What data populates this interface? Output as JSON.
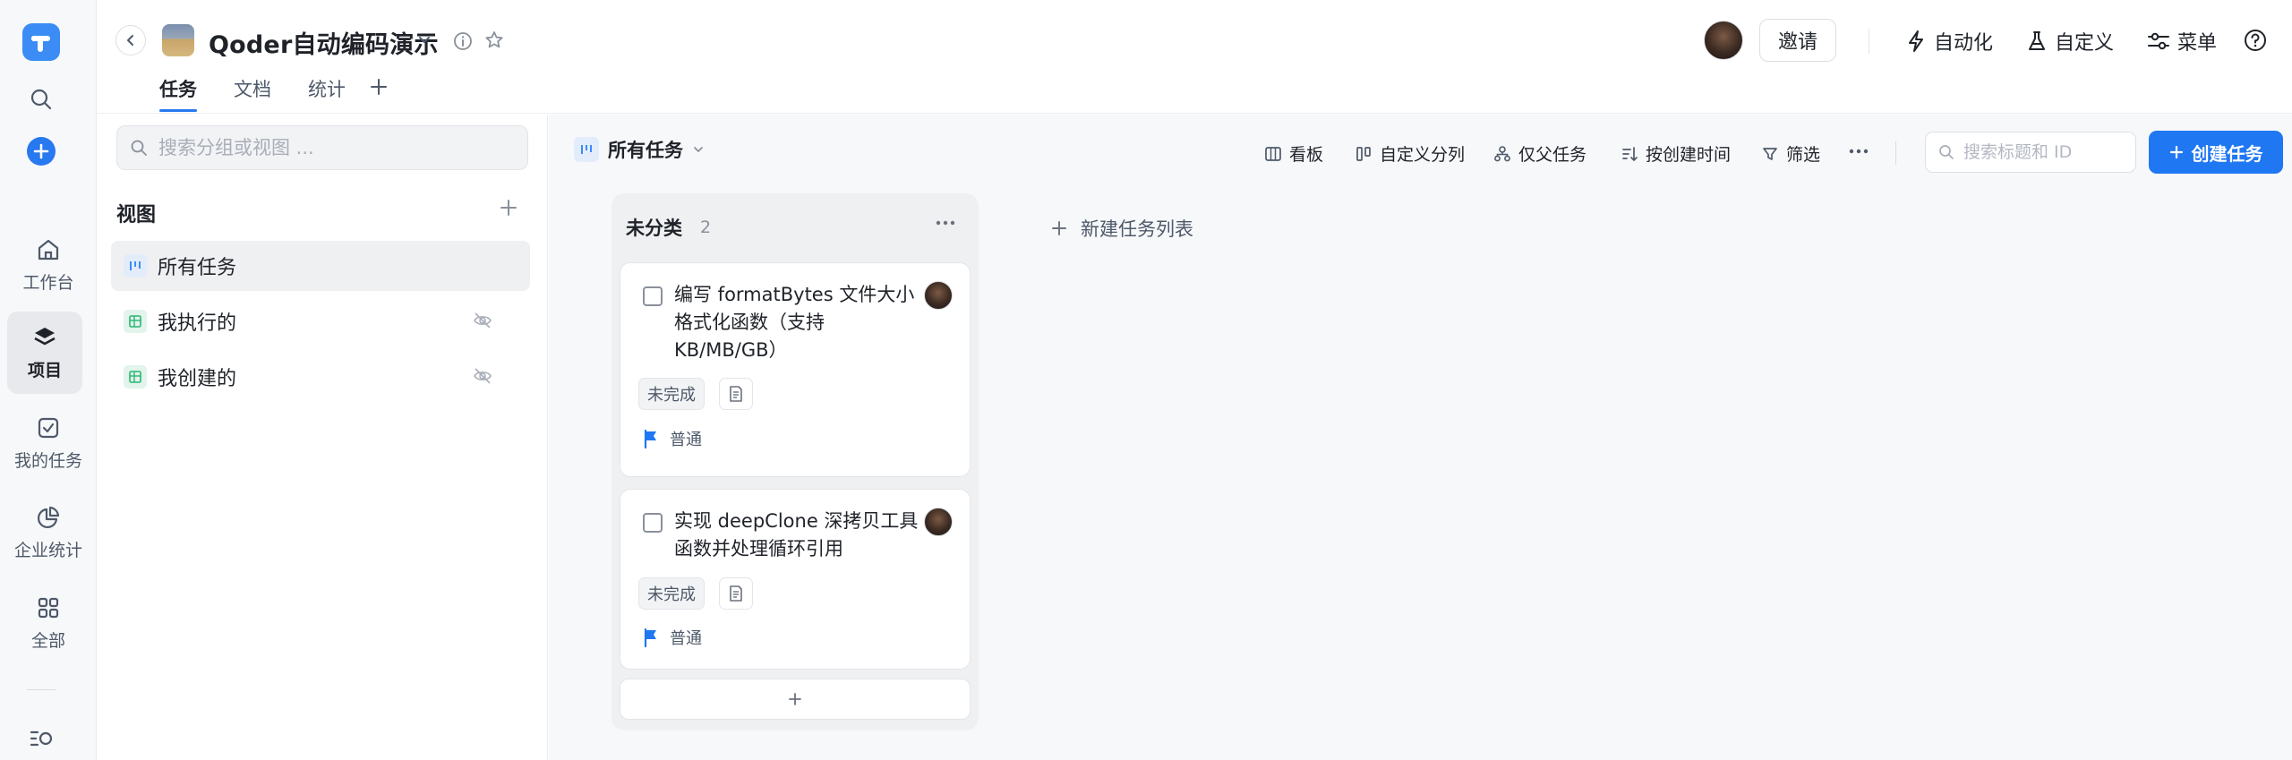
{
  "project": {
    "title": "Qoder自动编码演示"
  },
  "tabs": [
    {
      "label": "任务",
      "active": true
    },
    {
      "label": "文档",
      "active": false
    },
    {
      "label": "统计",
      "active": false
    }
  ],
  "rail": {
    "items": [
      {
        "label": "工作台",
        "icon": "home-icon"
      },
      {
        "label": "项目",
        "icon": "layers-icon",
        "active": true
      },
      {
        "label": "我的任务",
        "icon": "checkbox-icon"
      },
      {
        "label": "企业统计",
        "icon": "pie-chart-icon"
      },
      {
        "label": "全部",
        "icon": "grid-icon"
      }
    ]
  },
  "header": {
    "invite_label": "邀请",
    "automation_label": "自动化",
    "customize_label": "自定义",
    "menu_label": "菜单"
  },
  "views_panel": {
    "search_placeholder": "搜索分组或视图 ...",
    "title": "视图",
    "items": [
      {
        "label": "所有任务",
        "active": true,
        "icon": "board-view-icon"
      },
      {
        "label": "我执行的",
        "active": false,
        "icon": "table-view-icon",
        "hidden": true
      },
      {
        "label": "我创建的",
        "active": false,
        "icon": "table-view-icon",
        "hidden": true
      }
    ]
  },
  "toolbar": {
    "current_view": "所有任务",
    "kanban_label": "看板",
    "custom_columns_label": "自定义分列",
    "parent_only_label": "仅父任务",
    "sort_label": "按创建时间",
    "filter_label": "筛选",
    "search_placeholder": "搜索标题和 ID",
    "create_label": "创建任务"
  },
  "board": {
    "columns": [
      {
        "title": "未分类",
        "count": "2",
        "cards": [
          {
            "title": "编写 formatBytes 文件大小格式化函数（支持KB/MB/GB）",
            "status": "未完成",
            "priority": "普通"
          },
          {
            "title": "实现 deepClone 深拷贝工具函数并处理循环引用",
            "status": "未完成",
            "priority": "普通"
          }
        ]
      }
    ],
    "new_list_label": "新建任务列表"
  },
  "colors": {
    "accent": "#1f77f2",
    "priority_flag": "#1f77f2",
    "logo": "#3b8cf5"
  }
}
